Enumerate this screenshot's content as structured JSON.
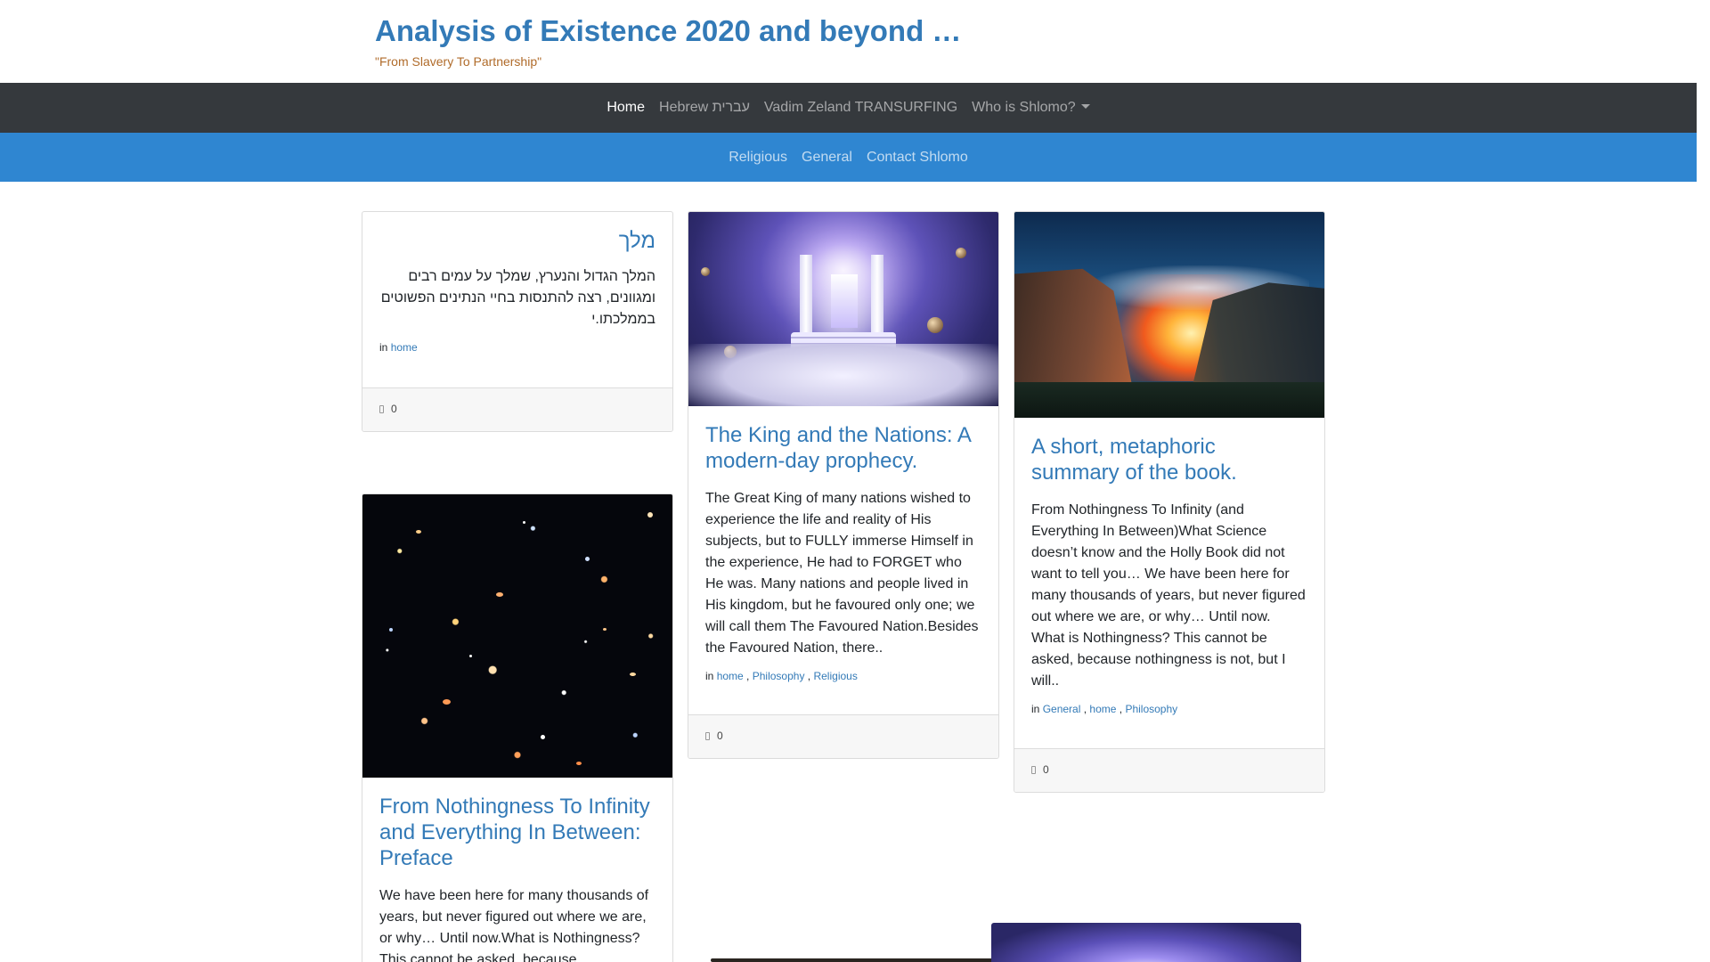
{
  "header": {
    "title": "Analysis of Existence 2020 and beyond …",
    "tagline": "\"From Slavery To Partnership\""
  },
  "nav_primary": [
    {
      "label": "Home",
      "active": true
    },
    {
      "label": "Hebrew עברית",
      "active": false
    },
    {
      "label": "Vadim Zeland TRANSURFING",
      "active": false
    },
    {
      "label": "Who is Shlomo?",
      "active": false,
      "dropdown": true
    }
  ],
  "nav_secondary": [
    {
      "label": "Religious"
    },
    {
      "label": "General"
    },
    {
      "label": "Contact Shlomo"
    }
  ],
  "posts": [
    {
      "title": "מלך",
      "excerpt": "המלך הגדול והנערץ, שמלך על עמים רבים ומגוונים, רצה להתנסות בחיי הנתינים הפשוטים בממלכתו.י",
      "in_label": "in",
      "categories": [
        "home"
      ],
      "comments": "0"
    },
    {
      "title": "The King and the Nations: A modern-day prophecy.",
      "excerpt": "The Great King of many nations wished to experience the life and reality of  His subjects, but to FULLY immerse Himself in the experience, He had to FORGET who He was. Many nations and people lived in His kingdom, but he favoured only one; we will call them The Favoured Nation.Besides the Favoured Nation, there..",
      "in_label": "in",
      "categories": [
        "home",
        "Philosophy",
        "Religious"
      ],
      "comments": "0",
      "image": "temple-in-clouds"
    },
    {
      "title": "A short, metaphoric summary of the book.",
      "excerpt": "From Nothingness To Infinity (and Everything In Between)What Science doesn’t know and the Holly Book did not want to tell you… We have been here for many thousands of years, but never figured out where we are, or why… Until now. What is Nothingness? This cannot be asked, because nothingness is not, but I will..",
      "in_label": "in",
      "categories": [
        "General",
        "home",
        "Philosophy"
      ],
      "comments": "0",
      "image": "canyon-fire-sunset"
    },
    {
      "title": "From Nothingness To Infinity and Everything In Between: Preface",
      "excerpt": "We have been here for many thousands of years, but never figured out where we are, or why… Until now.What is Nothingness? This cannot be asked, because",
      "image": "deep-field-galaxies"
    }
  ],
  "colors": {
    "link": "#337ab7",
    "nav_dark": "#35393d",
    "nav_blue": "#2f86d1",
    "tagline": "#b06b2a"
  }
}
